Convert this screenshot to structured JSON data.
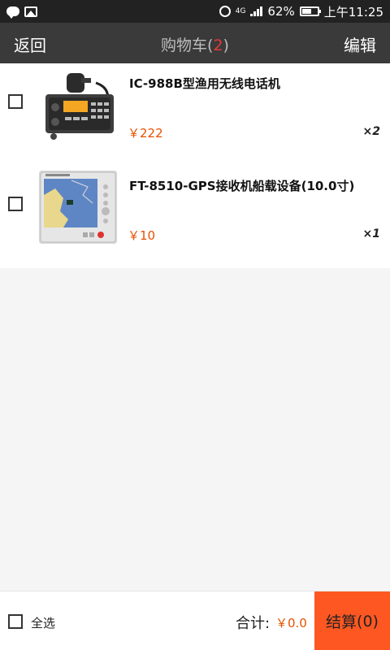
{
  "status_bar": {
    "icons": [
      "chat-icon",
      "image-icon",
      "alarm-icon",
      "signal-icon",
      "battery-icon"
    ],
    "network": "4G",
    "battery": "62%",
    "battery_level": 0.62,
    "time": "上午11:25"
  },
  "header": {
    "back_label": "返回",
    "title": "购物车",
    "count_open": "(",
    "count": "2",
    "count_close": ")",
    "edit_label": "编辑",
    "colors": {
      "background": "#3a3a3a",
      "count": "#e53935"
    }
  },
  "cart": {
    "items": [
      {
        "name": "IC-988B型渔用无线电话机",
        "price": "￥222",
        "quantity": "×2",
        "checked": false,
        "image": "marine-radio-image"
      },
      {
        "name": "FT-8510-GPS接收机船载设备(10.0寸)",
        "price": "￥10",
        "quantity": "×1",
        "checked": false,
        "image": "gps-chart-plotter-image"
      }
    ]
  },
  "footer": {
    "select_all_label": "全选",
    "total_label": "合计:",
    "total_value": "￥0.0",
    "checkout_label": "结算",
    "checkout_count": "(0)",
    "colors": {
      "price": "#e65100",
      "checkout": "#ff5722"
    }
  }
}
